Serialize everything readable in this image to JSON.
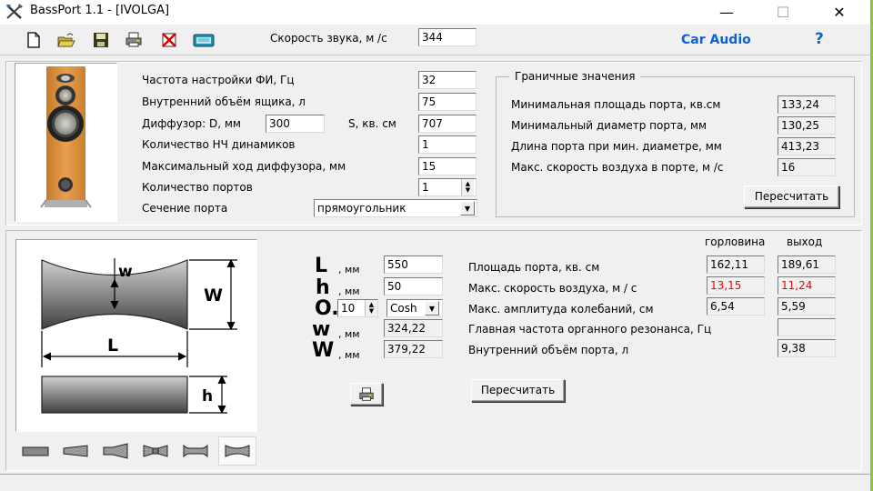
{
  "window": {
    "title": "BassPort 1.1 - [IVOLGA]",
    "minimize": "—",
    "maximize": "☐",
    "close": "✕"
  },
  "toolbar": {
    "icons": [
      "new-file-icon",
      "open-folder-icon",
      "save-icon",
      "print-icon",
      "delete-icon",
      "calculator-icon"
    ],
    "sound_speed_label": "Скорость звука, м /с",
    "sound_speed_value": "344",
    "car_audio_link": "Car Audio",
    "help": "?"
  },
  "params": {
    "tuning_freq_label": "Частота настройки ФИ, Гц",
    "tuning_freq_value": "32",
    "box_volume_label": "Внутренний объём ящика, л",
    "box_volume_value": "75",
    "cone_d_label": "Диффузор: D, мм",
    "cone_d_value": "300",
    "cone_s_label": "S, кв. см",
    "cone_s_value": "707",
    "woofer_count_label": "Количество НЧ динамиков",
    "woofer_count_value": "1",
    "max_excursion_label": "Максимальный ход диффузора, мм",
    "max_excursion_value": "15",
    "port_count_label": "Количество портов",
    "port_count_value": "1",
    "port_section_label": "Сечение порта",
    "port_section_value": "прямоугольник"
  },
  "limits": {
    "title": "Граничные значения",
    "rows": [
      {
        "label": "Минимальная площадь порта, кв.см",
        "value": "133,24"
      },
      {
        "label": "Минимальный диаметр порта, мм",
        "value": "130,25"
      },
      {
        "label": "Длина порта при мин. диаметре, мм",
        "value": "413,23"
      },
      {
        "label": "Макс. скорость воздуха в порте, м /с",
        "value": "16"
      }
    ],
    "recalc_label": "Пересчитать"
  },
  "port_dims": {
    "L_symbol": "L",
    "L_unit": ", мм",
    "L_value": "550",
    "h_symbol": "h",
    "h_unit": ", мм",
    "h_value": "50",
    "O_symbol": "O.",
    "O_value": "10",
    "profile_value": "Cosh",
    "w_symbol": "w",
    "w_unit": ", мм",
    "w_value": "324,22",
    "W_symbol": "W",
    "W_unit": ", мм",
    "W_value": "379,22"
  },
  "diagram": {
    "w_label": "w",
    "W_label": "W",
    "L_label": "L",
    "h_label": "h"
  },
  "results": {
    "col_throat": "горловина",
    "col_exit": "выход",
    "rows": [
      {
        "label": "Площадь порта, кв. см",
        "throat": "162,11",
        "exit": "189,61"
      },
      {
        "label": "Макс. скорость воздуха, м / с",
        "throat": "13,15",
        "exit": "11,24"
      },
      {
        "label": "Макс. амплитуда колебаний, см",
        "throat": "6,54",
        "exit": "5,59"
      },
      {
        "label": "Главная частота органного резонанса, Гц",
        "throat": "",
        "exit": ""
      },
      {
        "label": "Внутренний объём порта, л",
        "throat": "",
        "exit": "9,38"
      }
    ],
    "recalc_label": "Пересчитать",
    "alert_color": "#ff0000"
  },
  "shapes": [
    "straight",
    "conical",
    "horn",
    "double-flare",
    "flared-ends",
    "cosh-flared"
  ],
  "selected_shape": "cosh-flared"
}
